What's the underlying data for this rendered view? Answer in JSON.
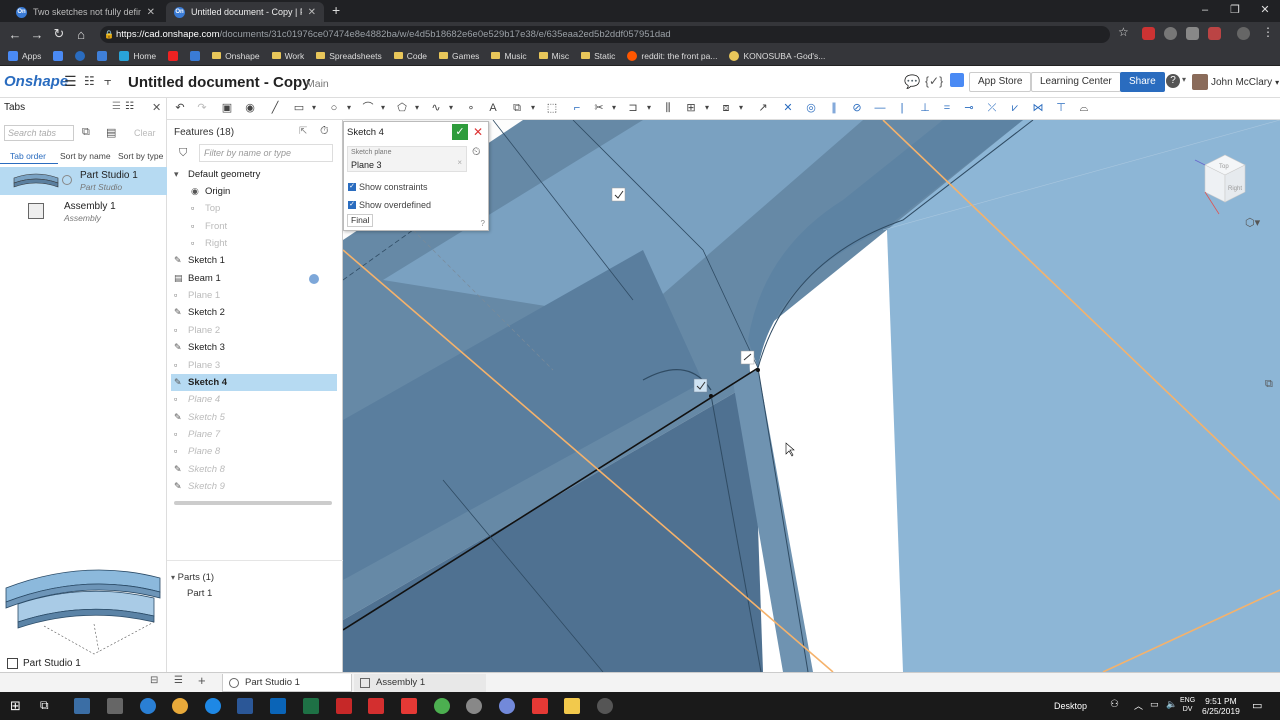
{
  "browser": {
    "tabs": [
      {
        "title": "Two sketches not fully defined. W",
        "active": false
      },
      {
        "title": "Untitled document - Copy | Part",
        "active": true
      }
    ],
    "new_tab": "+",
    "url_host": "https://cad.onshape.com",
    "url_path": "/documents/31c01976ce07474e8e4882ba/w/e4d5b18682e6e0e529b17e38/e/635eaa2ed5b2ddf057951dad",
    "bookmarks": [
      {
        "label": "Apps",
        "icon": "apps-grid-icon"
      },
      {
        "label": "",
        "icon": "onshape-bookmark-icon"
      },
      {
        "label": "",
        "icon": "onshape-bookmark-icon"
      },
      {
        "label": "",
        "icon": "shield-bookmark-icon"
      },
      {
        "label": "Home",
        "icon": "home-bookmark-icon"
      },
      {
        "label": "",
        "icon": "youtube-icon"
      },
      {
        "label": "",
        "icon": "bookmark-icon"
      },
      {
        "label": "Onshape",
        "icon": "folder-icon"
      },
      {
        "label": "Work",
        "icon": "folder-icon"
      },
      {
        "label": "Spreadsheets",
        "icon": "folder-icon"
      },
      {
        "label": "Code",
        "icon": "folder-icon"
      },
      {
        "label": "Games",
        "icon": "folder-icon"
      },
      {
        "label": "Music",
        "icon": "folder-icon"
      },
      {
        "label": "Misc",
        "icon": "folder-icon"
      },
      {
        "label": "Static",
        "icon": "folder-icon"
      },
      {
        "label": "reddit: the front pa...",
        "icon": "reddit-icon"
      },
      {
        "label": "KONOSUBA -God's...",
        "icon": "crown-icon"
      }
    ]
  },
  "onshape": {
    "logo": "Onshape",
    "doc_title": "Untitled document - Copy",
    "doc_version": "Main",
    "app_store": "App Store",
    "learning_center": "Learning Center",
    "share": "Share",
    "help": "?",
    "user": "John McClary"
  },
  "tabs_panel": {
    "title": "Tabs",
    "search_placeholder": "Search tabs",
    "clear": "Clear",
    "sort_options": [
      "Tab order",
      "Sort by name",
      "Sort by type"
    ],
    "items": [
      {
        "name": "Part Studio 1",
        "type": "Part Studio",
        "selected": true
      },
      {
        "name": "Assembly 1",
        "type": "Assembly",
        "selected": false
      }
    ]
  },
  "features": {
    "header": "Features (18)",
    "filter_placeholder": "Filter by name or type",
    "default_geometry": "Default geometry",
    "items": [
      {
        "label": "Origin",
        "state": "normal",
        "icon": "origin-dot-icon"
      },
      {
        "label": "Top",
        "state": "dim",
        "icon": "plane-icon"
      },
      {
        "label": "Front",
        "state": "dim",
        "icon": "plane-icon"
      },
      {
        "label": "Right",
        "state": "dim",
        "icon": "plane-icon"
      },
      {
        "label": "Sketch 1",
        "state": "normal",
        "icon": "pencil-icon"
      },
      {
        "label": "Beam 1",
        "state": "normal",
        "icon": "beam-icon"
      },
      {
        "label": "Plane 1",
        "state": "dim",
        "icon": "plane-icon"
      },
      {
        "label": "Sketch 2",
        "state": "normal",
        "icon": "pencil-icon"
      },
      {
        "label": "Plane 2",
        "state": "dim",
        "icon": "plane-icon"
      },
      {
        "label": "Sketch 3",
        "state": "normal",
        "icon": "pencil-icon"
      },
      {
        "label": "Plane 3",
        "state": "dim",
        "icon": "plane-icon"
      },
      {
        "label": "Sketch 4",
        "state": "selected",
        "icon": "pencil-icon"
      },
      {
        "label": "Plane 4",
        "state": "suppressed",
        "icon": "plane-icon"
      },
      {
        "label": "Sketch 5",
        "state": "suppressed",
        "icon": "pencil-icon"
      },
      {
        "label": "Plane 7",
        "state": "suppressed",
        "icon": "plane-icon"
      },
      {
        "label": "Plane 8",
        "state": "suppressed",
        "icon": "plane-icon"
      },
      {
        "label": "Sketch 8",
        "state": "suppressed",
        "icon": "pencil-icon"
      },
      {
        "label": "Sketch 9",
        "state": "suppressed",
        "icon": "pencil-icon"
      }
    ],
    "parts_header": "Parts (1)",
    "parts": [
      "Part 1"
    ]
  },
  "sketch_dialog": {
    "title": "Sketch 4",
    "plane_label": "Sketch plane",
    "plane_value": "Plane 3",
    "show_constraints": "Show constraints",
    "show_overdefined": "Show overdefined",
    "final": "Final"
  },
  "part_studio_thumb": {
    "label": "Part Studio 1"
  },
  "bottom_tabs": [
    {
      "label": "Part Studio 1",
      "active": true
    },
    {
      "label": "Assembly 1",
      "active": false
    }
  ],
  "viewcube": {
    "top": "Top",
    "right": "Right"
  },
  "taskbar": {
    "desktop_label": "Desktop",
    "lang_line1": "ENG",
    "lang_line2": "DV",
    "time": "9:51 PM",
    "date": "6/25/2019"
  },
  "colors": {
    "onshape_blue": "#2a6cbf",
    "selection": "#b6daf2",
    "model_top_face": "#8db6d6",
    "model_dark_face": "#4f7191",
    "sketch_orange": "#f5b26b"
  }
}
